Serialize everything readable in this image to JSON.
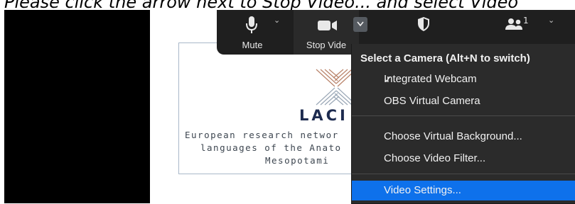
{
  "instruction": "Please click the arrow next to Stop Video... and select Video",
  "slide": {
    "logo_title": "LACI",
    "subtitle_line1": "European research networ",
    "subtitle_line2": "languages of the Anato",
    "subtitle_line3": "Mesopotami"
  },
  "toolbar": {
    "mute_label": "Mute",
    "stop_video_label": "Stop Vide",
    "participants_count": "1"
  },
  "camera_menu": {
    "header": "Select a Camera (Alt+N to switch)",
    "cameras": [
      {
        "label": "Integrated Webcam",
        "checked": true
      },
      {
        "label": "OBS Virtual Camera",
        "checked": false
      }
    ],
    "options": [
      {
        "label": "Choose Virtual Background..."
      },
      {
        "label": "Choose Video Filter..."
      }
    ],
    "settings": {
      "label": "Video Settings...",
      "highlighted": true
    }
  },
  "colors": {
    "toolbar_bg": "#1f1f1f",
    "menu_bg": "#2b2b2b",
    "highlight": "#0e71eb",
    "logo_text": "#1d2b4f"
  }
}
